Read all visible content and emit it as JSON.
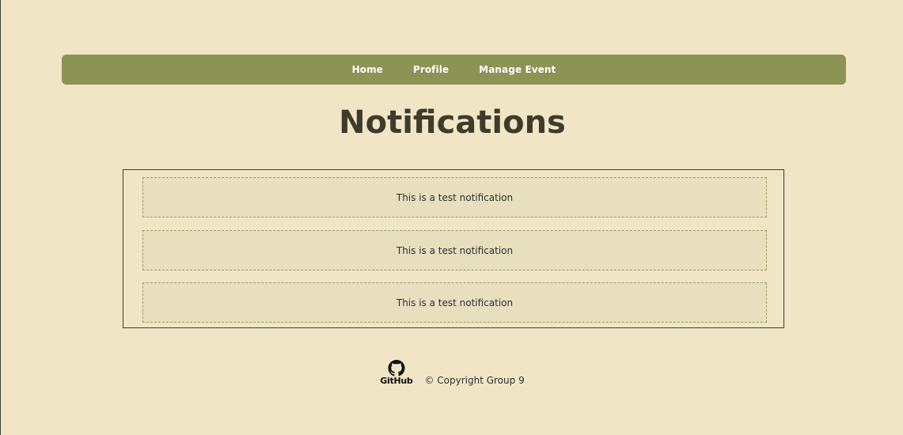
{
  "nav": {
    "items": [
      {
        "label": "Home"
      },
      {
        "label": "Profile"
      },
      {
        "label": "Manage Event"
      }
    ]
  },
  "page": {
    "title": "Notifications"
  },
  "notifications": [
    {
      "text": "This is a test notification"
    },
    {
      "text": "This is a test notification"
    },
    {
      "text": "This is a test notification"
    }
  ],
  "footer": {
    "github_label": "GitHub",
    "copyright": "© Copyright Group 9"
  },
  "colors": {
    "background": "#f0e6c6",
    "navbar": "#8b9355",
    "title": "#3f3b2c",
    "notification_bg": "#e8dfbf",
    "notification_border": "#9a9a66"
  }
}
